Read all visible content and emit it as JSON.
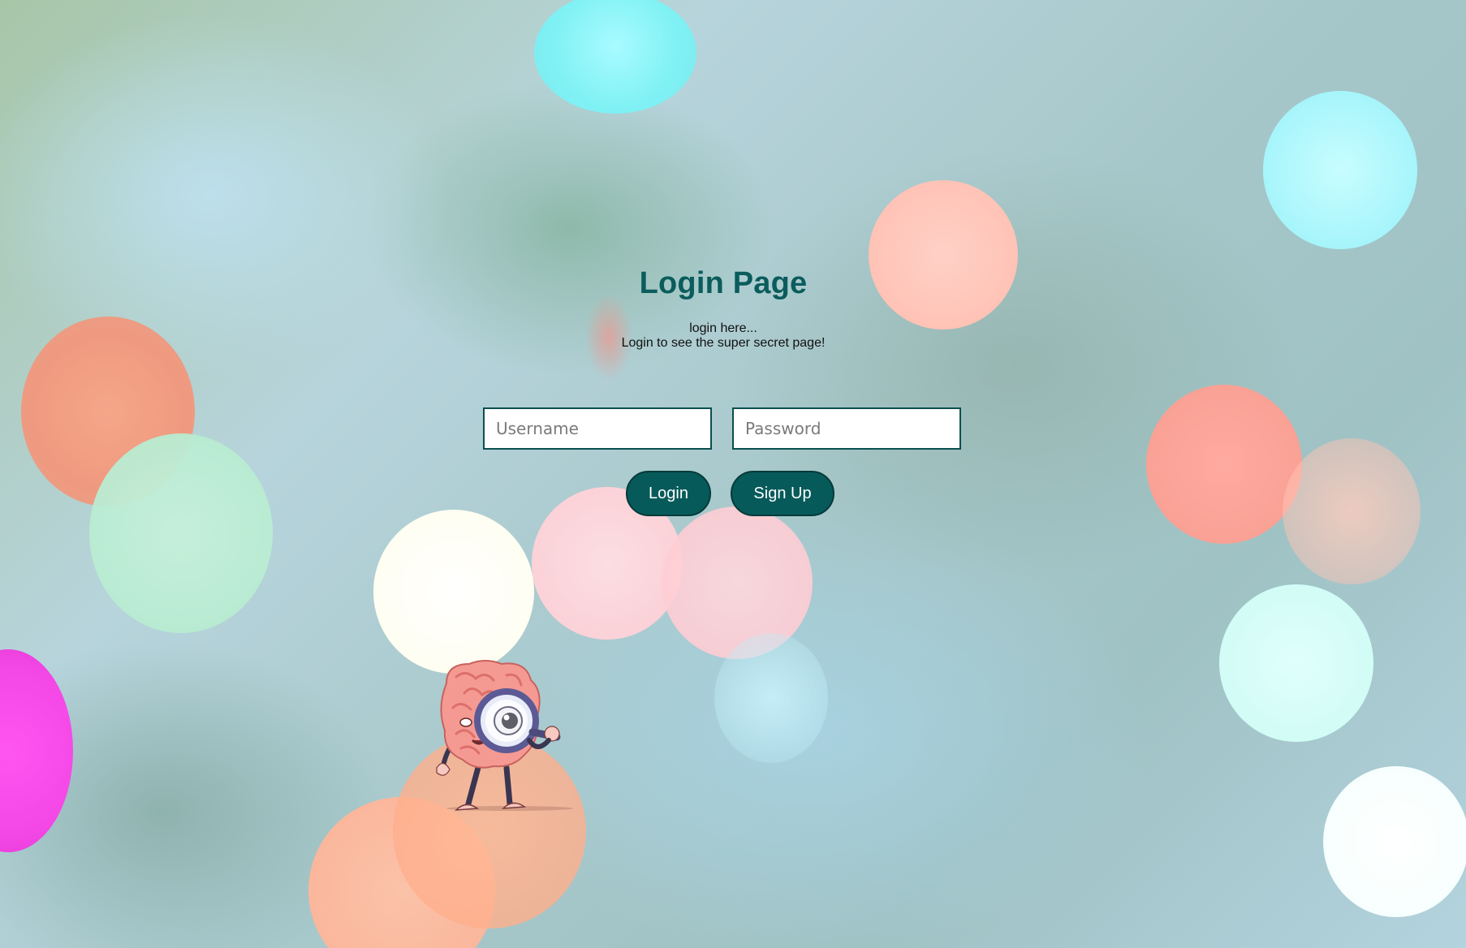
{
  "page": {
    "title": "Login Page",
    "subtitle_line1": "login here...",
    "subtitle_line2": "Login to see the super secret page!"
  },
  "form": {
    "username_placeholder": "Username",
    "password_placeholder": "Password",
    "login_label": "Login",
    "signup_label": "Sign Up"
  },
  "colors": {
    "title": "#0b5c5c",
    "button": "#075a5a"
  },
  "icons": {
    "mascot": "brain-with-magnifier-icon"
  }
}
